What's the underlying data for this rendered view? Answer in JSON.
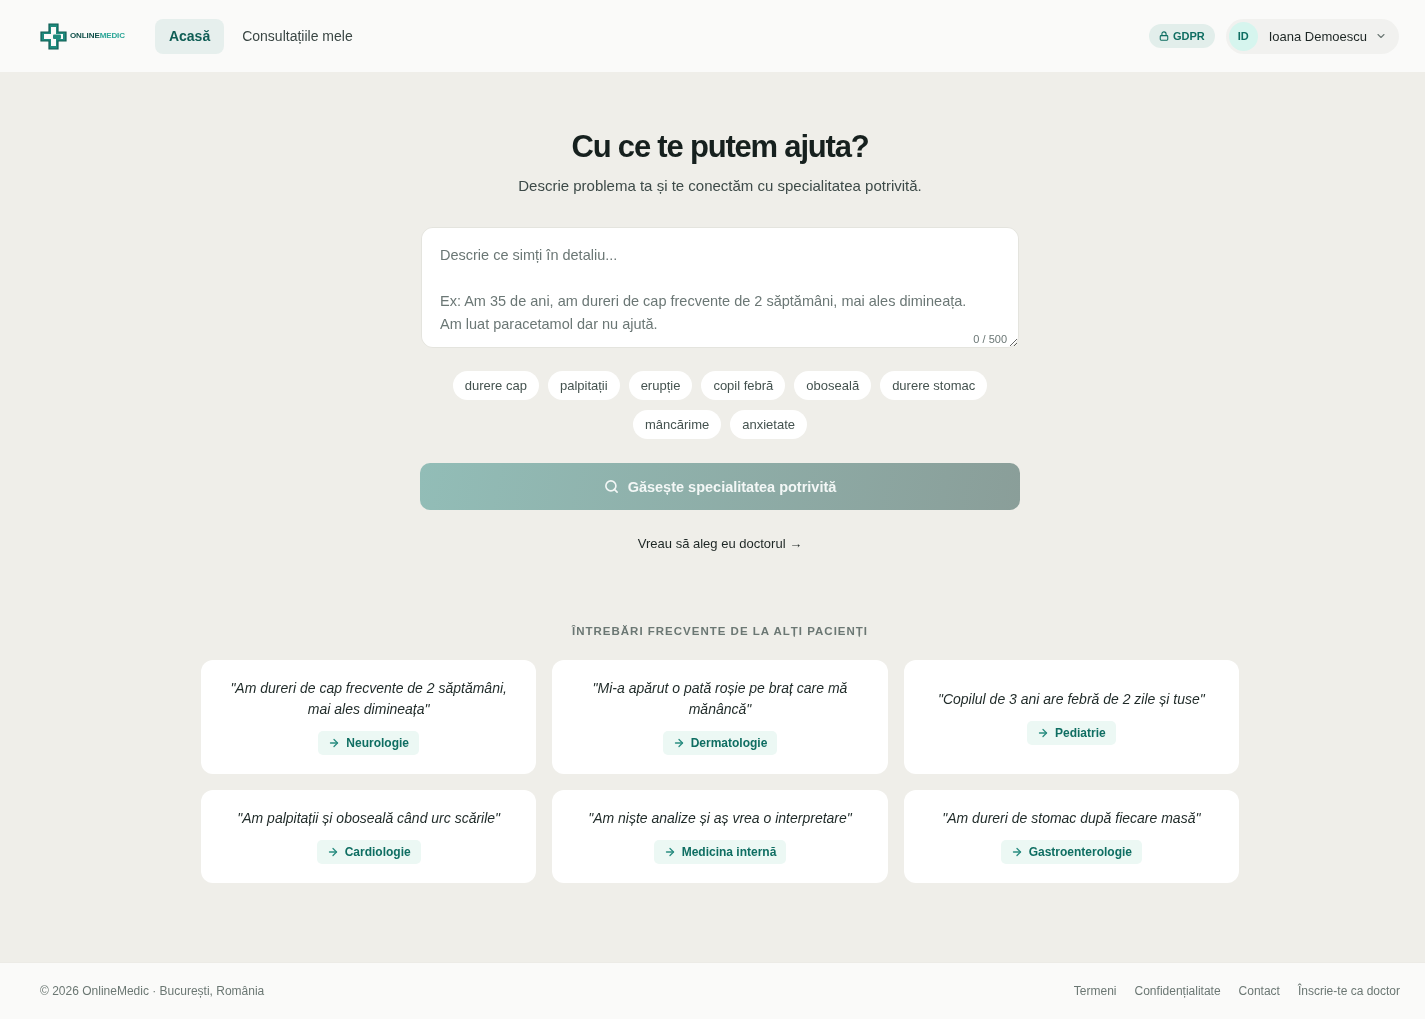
{
  "header": {
    "logo": {
      "text_1": "ONLINE",
      "text_2": "MEDIC"
    },
    "nav": [
      {
        "label": "Acasă",
        "selected": true
      },
      {
        "label": "Consultațiile mele",
        "selected": false
      }
    ],
    "gdpr_badge": "GDPR",
    "user": {
      "initials": "ID",
      "name": "Ioana Demoescu"
    }
  },
  "hero": {
    "title": "Cu ce te putem ajuta?",
    "subtitle": "Descrie problema ta și te conectăm cu specialitatea potrivită."
  },
  "symptom_input": {
    "placeholder": "Descrie ce simți în detaliu...\n\nEx: Am 35 de ani, am dureri de cap frecvente de 2 săptămâni, mai ales dimineața.\nAm luat paracetamol dar nu ajută.",
    "counter": "0 / 500"
  },
  "suggestions": [
    "durere cap",
    "palpitații",
    "erupție",
    "copil febră",
    "oboseală",
    "durere stomac",
    "mâncărime",
    "anxietate"
  ],
  "search_button": {
    "label": "Găsește specialitatea potrivită",
    "disabled": true
  },
  "choose_doctor_link": "Vreau să aleg eu doctorul →",
  "faq": {
    "heading": "ÎNTREBĂRI FRECVENTE DE LA ALȚI PACIENȚI",
    "cards": [
      {
        "quote": "\"Am dureri de cap frecvente de 2 săptămâni, mai ales dimineața\"",
        "specialty": "Neurologie"
      },
      {
        "quote": "\"Mi-a apărut o pată roșie pe braț care mă mănâncă\"",
        "specialty": "Dermatologie"
      },
      {
        "quote": "\"Copilul de 3 ani are febră de 2 zile și tuse\"",
        "specialty": "Pediatrie"
      },
      {
        "quote": "\"Am palpitații și oboseală când urc scările\"",
        "specialty": "Cardiologie"
      },
      {
        "quote": "\"Am niște analize și aș vrea o interpretare\"",
        "specialty": "Medicina internă"
      },
      {
        "quote": "\"Am dureri de stomac după fiecare masă\"",
        "specialty": "Gastroenterologie"
      }
    ]
  },
  "footer": {
    "copyright": "© 2026 OnlineMedic · București, România",
    "links": [
      "Termeni",
      "Confidențialitate",
      "Contact",
      "Înscrie-te ca doctor"
    ]
  }
}
